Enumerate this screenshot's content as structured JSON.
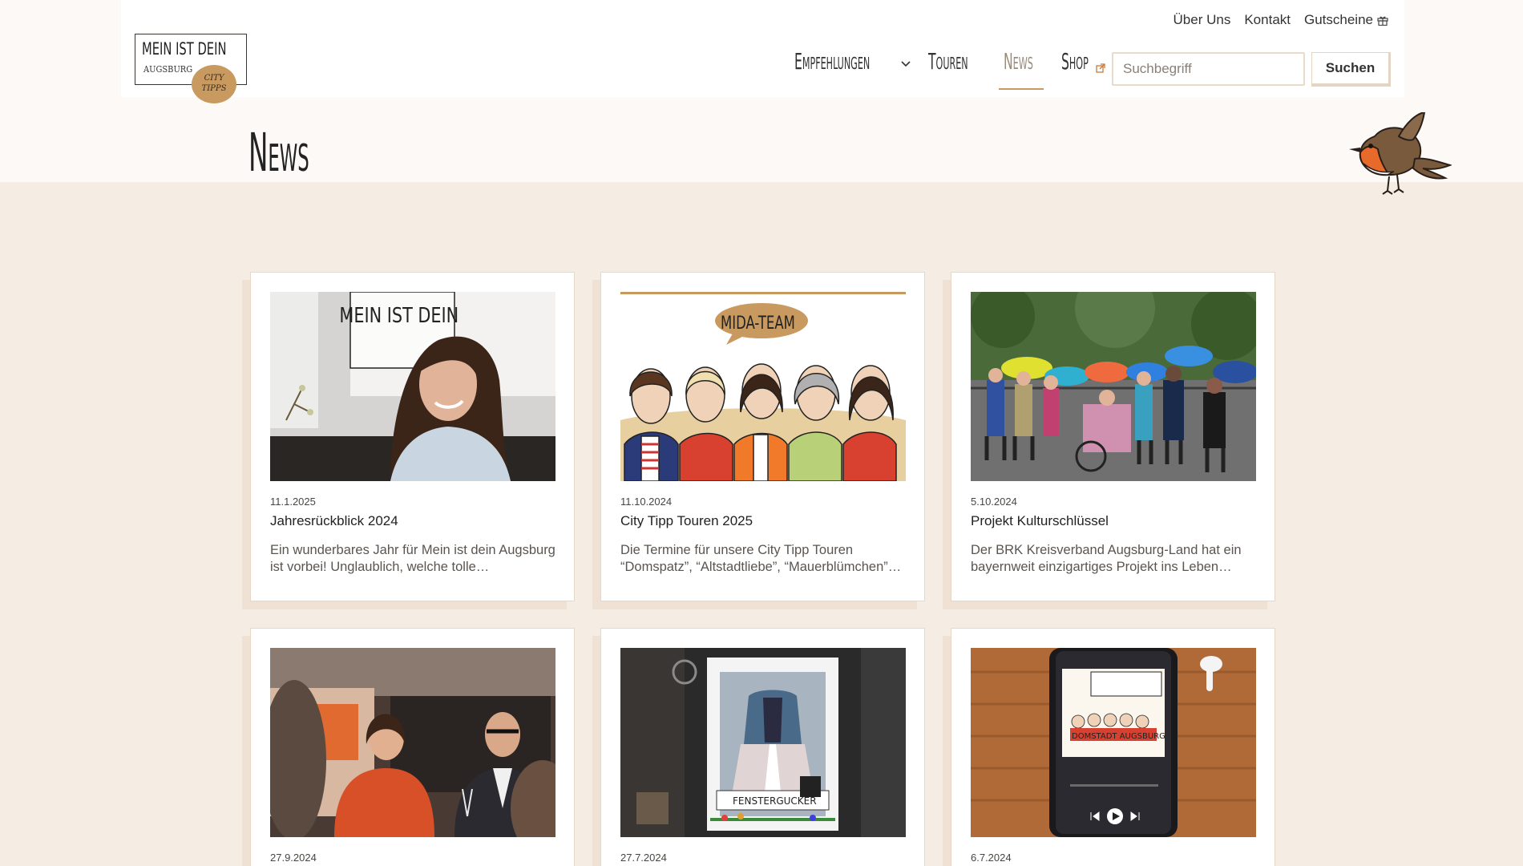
{
  "header": {
    "logo": {
      "main": "MEIN IST DEIN",
      "sub": "AUGSBURG",
      "badge_line1": "CITY",
      "badge_line2": "TIPPS"
    },
    "meta_nav": [
      {
        "label": "Über Uns",
        "icon": ""
      },
      {
        "label": "Kontakt",
        "icon": ""
      },
      {
        "label": "Gutscheine",
        "icon": "gift-icon"
      }
    ],
    "main_nav": [
      {
        "label": "Empfehlungen",
        "icon": "chevron-down-icon",
        "active": false
      },
      {
        "label": "Touren",
        "icon": "",
        "active": false
      },
      {
        "label": "News",
        "icon": "",
        "active": true
      },
      {
        "label": "Shop",
        "icon": "external-link-icon",
        "active": false
      }
    ],
    "search": {
      "placeholder": "Suchbegriff",
      "button": "Suchen"
    }
  },
  "page": {
    "title": "News",
    "mascot": "robin-bird-icon"
  },
  "colors": {
    "accent": "#c99a60",
    "background": "#f5ece3",
    "header_band": "#fdf9f6",
    "card_border": "#e6d7c7",
    "card_shadow": "#efe2d4"
  },
  "cards": [
    {
      "date": "11.1.2025",
      "title": "Jahresrückblick 2024",
      "excerpt": "Ein wunderbares Jahr für Mein ist dein Augsburg ist vorbei! Unglaublich, welche tolle…",
      "image": "woman-smiling-in-front-of-logo-photo",
      "image_text": "MEIN IST DEIN"
    },
    {
      "date": "11.10.2024",
      "title": "City Tipp Touren 2025",
      "excerpt": "Die Termine für unsere City Tipp Touren “Domspatz”, “Altstadtliebe”, “Mauerblümchen”…",
      "image": "mida-team-illustration",
      "image_text": "MIDA-TEAM"
    },
    {
      "date": "5.10.2024",
      "title": "Projekt Kulturschlüssel",
      "excerpt": "Der BRK Kreisverband Augsburg-Land hat ein bayernweit einzigartiges Projekt ins Leben…",
      "image": "group-with-umbrellas-photo",
      "image_text": ""
    },
    {
      "date": "27.9.2024",
      "title": "",
      "excerpt": "",
      "image": "event-people-with-wine-glasses-photo",
      "image_text": ""
    },
    {
      "date": "27.7.2024",
      "title": "",
      "excerpt": "",
      "image": "shop-window-dirndl-photo",
      "image_text": "FENSTERGUCKER"
    },
    {
      "date": "6.7.2024",
      "title": "",
      "excerpt": "",
      "image": "podcast-on-smartphone-photo",
      "image_text": "DOMSTADT AUGSBURG"
    }
  ]
}
